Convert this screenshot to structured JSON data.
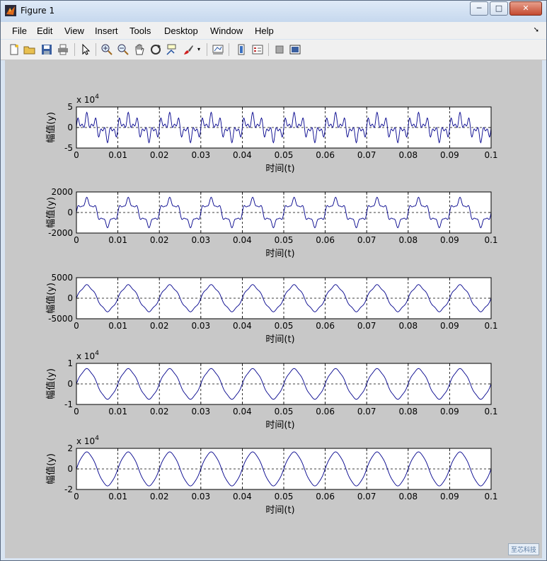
{
  "window": {
    "title": "Figure 1",
    "minimize": "─",
    "maximize": "□",
    "close": "✕"
  },
  "menu": [
    "File",
    "Edit",
    "View",
    "Insert",
    "Tools",
    "Desktop",
    "Window",
    "Help"
  ],
  "toolbar_icons": [
    "new-figure-icon",
    "open-file-icon",
    "save-icon",
    "print-icon",
    "pointer-icon",
    "zoom-in-icon",
    "zoom-out-icon",
    "pan-icon",
    "rotate-3d-icon",
    "data-cursor-icon",
    "brush-icon",
    "link-plot-icon",
    "colorbar-icon",
    "legend-icon",
    "hide-plot-tools-icon",
    "show-plot-tools-icon"
  ],
  "watermark": "至芯科技",
  "chart_data": [
    {
      "type": "line",
      "xlabel": "时间(t)",
      "ylabel": "幅值(y)",
      "exponent": "x 10",
      "exponent_power": "4",
      "yticks": [
        "5",
        "0",
        "-5"
      ],
      "ylim": [
        -5,
        5
      ],
      "xlim": [
        0,
        0.1
      ],
      "xticks": [
        "0",
        "0.01",
        "0.02",
        "0.03",
        "0.04",
        "0.05",
        "0.06",
        "0.07",
        "0.08",
        "0.09",
        "0.1"
      ],
      "grid": "dashed",
      "components": [
        {
          "amp": 1.5,
          "freq": 100
        },
        {
          "amp": 1.3,
          "freq": 500
        },
        {
          "amp": 0.9,
          "freq": 900
        }
      ]
    },
    {
      "type": "line",
      "xlabel": "时间(t)",
      "ylabel": "幅值(y)",
      "yticks": [
        "2000",
        "0",
        "-2000"
      ],
      "ylim": [
        -2000,
        2000
      ],
      "xlim": [
        0,
        0.1
      ],
      "xticks": [
        "0",
        "0.01",
        "0.02",
        "0.03",
        "0.04",
        "0.05",
        "0.06",
        "0.07",
        "0.08",
        "0.09",
        "0.1"
      ],
      "grid": "dashed",
      "components": [
        {
          "amp": 1050,
          "freq": 100
        },
        {
          "amp": 320,
          "freq": 500
        },
        {
          "amp": 120,
          "freq": 900
        }
      ]
    },
    {
      "type": "line",
      "xlabel": "时间(t)",
      "ylabel": "幅值(y)",
      "yticks": [
        "5000",
        "0",
        "-5000"
      ],
      "ylim": [
        -5000,
        5000
      ],
      "xlim": [
        0,
        0.1
      ],
      "xticks": [
        "0",
        "0.01",
        "0.02",
        "0.03",
        "0.04",
        "0.05",
        "0.06",
        "0.07",
        "0.08",
        "0.09",
        "0.1"
      ],
      "grid": "dashed",
      "components": [
        {
          "amp": 3100,
          "freq": 100
        },
        {
          "amp": 220,
          "freq": 500
        }
      ]
    },
    {
      "type": "line",
      "xlabel": "时间(t)",
      "ylabel": "幅值(y)",
      "exponent": "x 10",
      "exponent_power": "4",
      "yticks": [
        "1",
        "0",
        "-1"
      ],
      "ylim": [
        -1,
        1
      ],
      "xlim": [
        0,
        0.1
      ],
      "xticks": [
        "0",
        "0.01",
        "0.02",
        "0.03",
        "0.04",
        "0.05",
        "0.06",
        "0.07",
        "0.08",
        "0.09",
        "0.1"
      ],
      "grid": "dashed",
      "components": [
        {
          "amp": 0.72,
          "freq": 100
        },
        {
          "amp": 0.03,
          "freq": 500
        }
      ]
    },
    {
      "type": "line",
      "xlabel": "时间(t)",
      "ylabel": "幅值(y)",
      "exponent": "x 10",
      "exponent_power": "4",
      "yticks": [
        "2",
        "0",
        "-2"
      ],
      "ylim": [
        -2,
        2
      ],
      "xlim": [
        0,
        0.1
      ],
      "xticks": [
        "0",
        "0.01",
        "0.02",
        "0.03",
        "0.04",
        "0.05",
        "0.06",
        "0.07",
        "0.08",
        "0.09",
        "0.1"
      ],
      "grid": "dashed",
      "components": [
        {
          "amp": 1.62,
          "freq": 100
        },
        {
          "amp": 0.04,
          "freq": 500
        }
      ]
    }
  ]
}
